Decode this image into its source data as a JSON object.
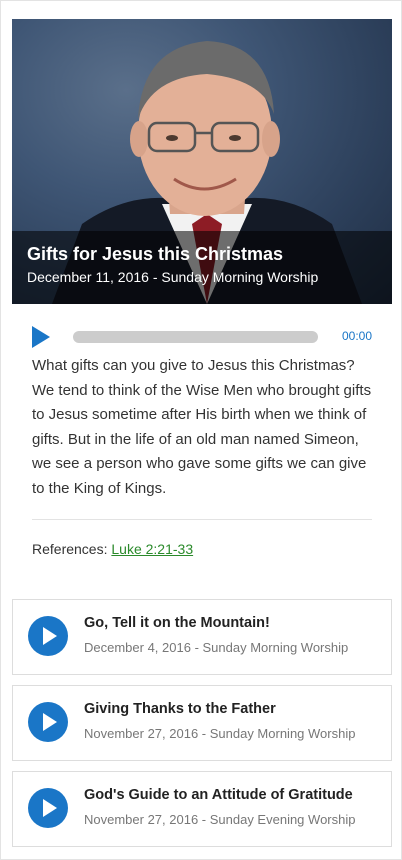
{
  "featured": {
    "title": "Gifts for Jesus this Christmas",
    "subtitle": "December 11, 2016 - Sunday Morning Worship",
    "player": {
      "time": "00:00",
      "progress": 0
    },
    "description": "What gifts can you give to Jesus this Christmas? We tend to think of the Wise Men who brought gifts to Jesus sometime after His birth when we think of gifts. But in the life of an old man named Simeon, we see a person who gave some gifts we can give to the King of Kings.",
    "references_label": "References:",
    "reference_link": "Luke 2:21-33"
  },
  "sermons": [
    {
      "title": "Go, Tell it on the Mountain!",
      "meta": "December 4, 2016 - Sunday Morning Worship"
    },
    {
      "title": "Giving Thanks to the Father",
      "meta": "November 27, 2016 - Sunday Morning Worship"
    },
    {
      "title": "God's Guide to an Attitude of Gratitude",
      "meta": "November 27, 2016 - Sunday Evening Worship"
    }
  ],
  "colors": {
    "accent": "#1a76c7",
    "link": "#2b8a2b"
  },
  "icons": {
    "play": "play-icon"
  }
}
